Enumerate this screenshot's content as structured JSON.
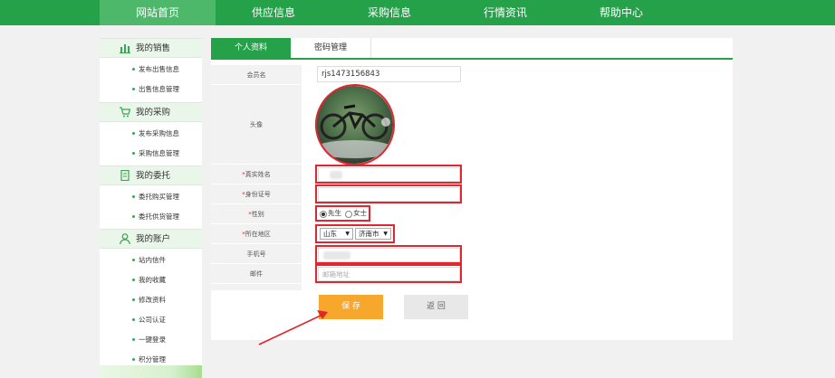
{
  "nav": {
    "items": [
      "网站首页",
      "供应信息",
      "采购信息",
      "行情资讯",
      "帮助中心"
    ],
    "active_index": 0
  },
  "sidebar": {
    "sections": [
      {
        "title": "我的销售",
        "icon": "chart-bars-icon",
        "items": [
          "发布出售信息",
          "出售信息管理"
        ]
      },
      {
        "title": "我的采购",
        "icon": "cart-icon",
        "items": [
          "发布采购信息",
          "采购信息管理"
        ]
      },
      {
        "title": "我的委托",
        "icon": "document-icon",
        "items": [
          "委托购买管理",
          "委托供货管理"
        ]
      },
      {
        "title": "我的账户",
        "icon": "user-icon",
        "items": [
          "站内信件",
          "我的收藏",
          "修改资料",
          "公司认证",
          "一键登录",
          "积分管理"
        ]
      }
    ]
  },
  "tabs": [
    "个人资料",
    "密码管理"
  ],
  "form": {
    "member_label": "会员名",
    "member_value": "rjs1473156843",
    "avatar_label": "头像",
    "realname_label": "真实姓名",
    "idcard_label": "身份证号",
    "gender_label": "性别",
    "gender_options": [
      "先生",
      "女士"
    ],
    "region_label": "所在地区",
    "province": "山东",
    "city": "济南市",
    "phone_label": "手机号",
    "email_label": "邮件",
    "email_placeholder": "邮箱地址",
    "required_mark": "*"
  },
  "buttons": {
    "save": "保 存",
    "back": "返 回"
  },
  "colors": {
    "brand": "#25a14a",
    "highlight": "#e0262e",
    "save": "#f7a82c"
  }
}
